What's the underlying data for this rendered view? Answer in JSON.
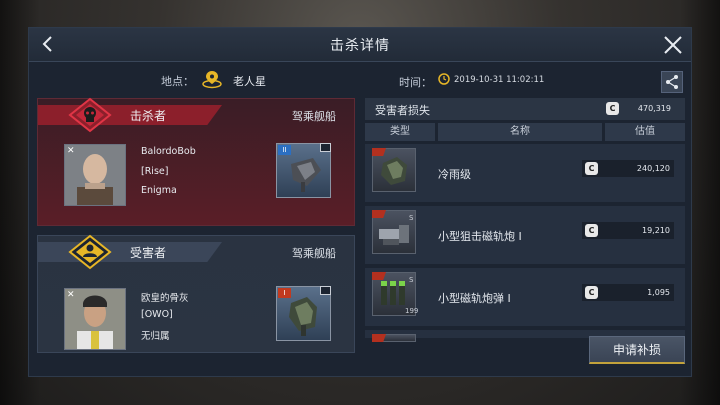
{
  "window": {
    "title": "击杀详情"
  },
  "info": {
    "location_label": "地点：",
    "location_value": "老人星",
    "time_label": "时间：",
    "time_value": "2019-10-31 11:02:11"
  },
  "killer": {
    "label": "击杀者",
    "ship_label": "驾乘舰船",
    "name": "BalordoBob",
    "corp": "[Rise]",
    "alliance": "Enigma",
    "ship_tier": "II"
  },
  "victim": {
    "label": "受害者",
    "ship_label": "驾乘舰船",
    "name": "欧皇的骨灰",
    "corp": "[OWO]",
    "alliance": "无归属",
    "ship_tier": "I"
  },
  "loss": {
    "title": "受害者损失",
    "total": "470,319",
    "columns": [
      "类型",
      "名称",
      "估值"
    ],
    "items": [
      {
        "name": "冷雨级",
        "value": "240,120",
        "qty": "",
        "icon": "ship-icon"
      },
      {
        "name": "小型狙击磁轨炮 I",
        "value": "19,210",
        "qty": "",
        "small": "S",
        "icon": "railgun-icon"
      },
      {
        "name": "小型磁轨炮弹 I",
        "value": "1,095",
        "qty": "199",
        "small": "S",
        "icon": "ammo-icon"
      }
    ]
  },
  "actions": {
    "claim_label": "申请补损"
  },
  "colors": {
    "accent_red": "#8c1f2b",
    "accent_gold": "#e7b627",
    "panel_bg": "#1c2431"
  }
}
